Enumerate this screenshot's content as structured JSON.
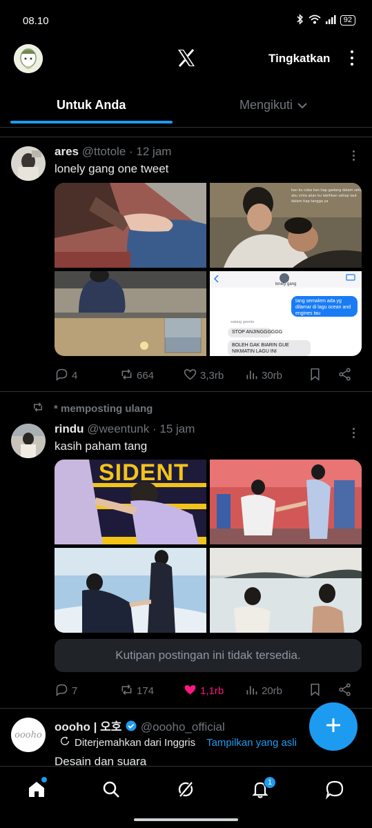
{
  "status": {
    "time": "08.10",
    "battery": "92"
  },
  "header": {
    "upgrade_label": "Tingkatkan"
  },
  "tabs": [
    {
      "label": "Untuk Anda"
    },
    {
      "label": "Mengikuti"
    }
  ],
  "posts": [
    {
      "name": "ares",
      "handle": "@ttotole",
      "time": "· 12 jam",
      "text": "lonely gang one tweet",
      "images": [
        {
          "desc": "hands-on-knee",
          "colors": [
            "#8a4a44",
            "#3a5a8a"
          ]
        },
        {
          "desc": "two-people-embrace",
          "colors": [
            "#6b5e4a",
            "#2a2a2a"
          ],
          "caption": "kan ku coba kan tiap gadang dalam setiap aku cinta akan ku lebihkan setiap laut dalam tiap tangga ya"
        },
        {
          "desc": "sunset-beach",
          "colors": [
            "#8c8a84",
            "#2c3e50"
          ]
        },
        {
          "desc": "chat-screenshot",
          "chat": {
            "contact": "lonely gang",
            "out": "tang semalem ada yg dilamar di lagu ocean and engines tau",
            "sender": "salang gmmts",
            "in1": "STOP ANJINGGGGGG",
            "in2": "BOLEH GAK BIARIN GUE NIKMATIN LAGU INI"
          }
        }
      ],
      "stats": {
        "replies": "4",
        "reposts": "664",
        "likes": "3,3rb",
        "views": "30rb"
      }
    },
    {
      "repost_label": "* memposting ulang",
      "name": "rindu",
      "handle": "@weentunk",
      "time": "· 15 jam",
      "text": "kasih paham tang",
      "images": [
        {
          "desc": "stage-president-banner",
          "banner": "SIDENT"
        },
        {
          "desc": "stage-couple-hands"
        },
        {
          "desc": "kneeling-proposal"
        },
        {
          "desc": "two-people-in-sea"
        }
      ],
      "quote_unavailable": "Kutipan postingan ini tidak tersedia.",
      "stats": {
        "replies": "7",
        "reposts": "174",
        "likes": "1,1rb",
        "views": "20rb"
      }
    },
    {
      "name": "oooho | 오호",
      "handle": "@oooho_official",
      "avatar_text": "oooho",
      "translated_label": "Diterjemahkan dari Inggris",
      "show_original_label": "Tampilkan yang asli",
      "text": "Desain dan suara"
    }
  ],
  "nav": {
    "notification_count": "1"
  },
  "accent_color": "#1d9bf0",
  "like_color": "#f91880"
}
